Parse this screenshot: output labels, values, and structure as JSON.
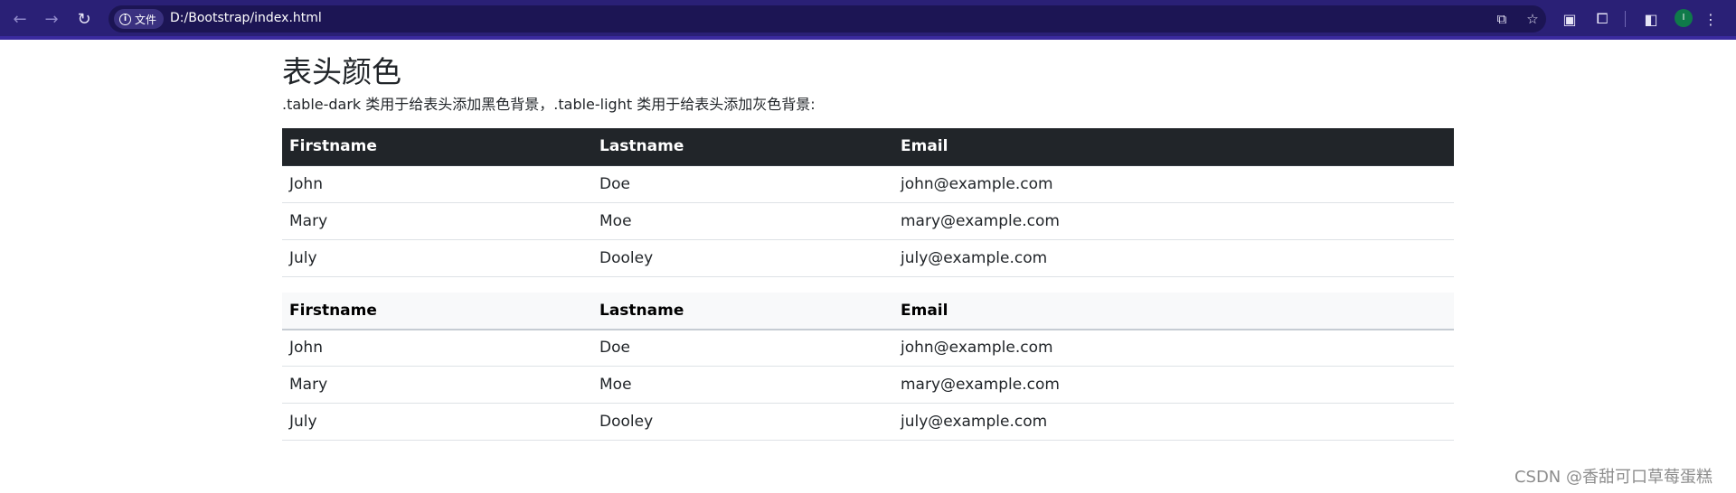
{
  "browser": {
    "site_chip_label": "文件",
    "url": "D:/Bootstrap/index.html",
    "avatar_initial": "I",
    "accent_color": "#2a2076"
  },
  "page": {
    "title": "表头颜色",
    "description": ".table-dark 类用于给表头添加黑色背景，.table-light 类用于给表头添加灰色背景:"
  },
  "tables": {
    "dark": {
      "headers": [
        "Firstname",
        "Lastname",
        "Email"
      ],
      "rows": [
        [
          "John",
          "Doe",
          "john@example.com"
        ],
        [
          "Mary",
          "Moe",
          "mary@example.com"
        ],
        [
          "July",
          "Dooley",
          "july@example.com"
        ]
      ]
    },
    "light": {
      "headers": [
        "Firstname",
        "Lastname",
        "Email"
      ],
      "rows": [
        [
          "John",
          "Doe",
          "john@example.com"
        ],
        [
          "Mary",
          "Moe",
          "mary@example.com"
        ],
        [
          "July",
          "Dooley",
          "july@example.com"
        ]
      ]
    }
  },
  "watermark": "CSDN @香甜可口草莓蛋糕"
}
